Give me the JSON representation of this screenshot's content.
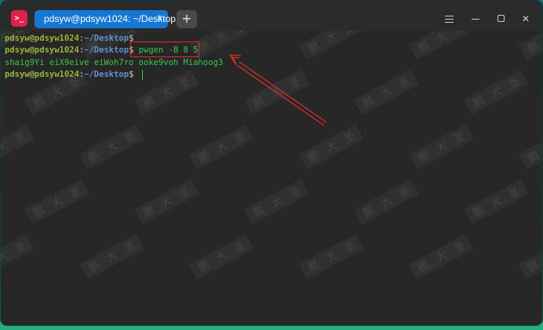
{
  "window": {
    "tab_title": "pdsyw@pdsyw1024: ~/Desktop",
    "tab_close": "✕",
    "new_tab": "+",
    "app_icon": "terminal-icon",
    "controls": [
      "menu-icon",
      "minimize-icon",
      "maximize-icon",
      "close-icon"
    ]
  },
  "terminal": {
    "lines": [
      {
        "user": "pdsyw@pdsyw1024",
        "colon": ":",
        "path": "~/Desktop",
        "dollar": "$",
        "command": ""
      },
      {
        "user": "pdsyw@pdsyw1024",
        "colon": ":",
        "path": "~/Desktop",
        "dollar": "$",
        "command": " pwgen -B 8 5"
      },
      {
        "output": "shaig9Yi eiX9eive eiWoh7ro ooke9voh Miahoog3"
      },
      {
        "user": "pdsyw@pdsyw1024",
        "colon": ":",
        "path": "~/Desktop",
        "dollar": "$",
        "command": " "
      }
    ]
  },
  "colors": {
    "user": "#99b43b",
    "path": "#6390c9",
    "command": "#3ec44a",
    "annotation": "#e02d2d",
    "tab": "#1677d3",
    "app_icon": "#e0214b"
  },
  "watermark": {
    "chars": [
      "鹏",
      "大",
      "圣"
    ]
  }
}
